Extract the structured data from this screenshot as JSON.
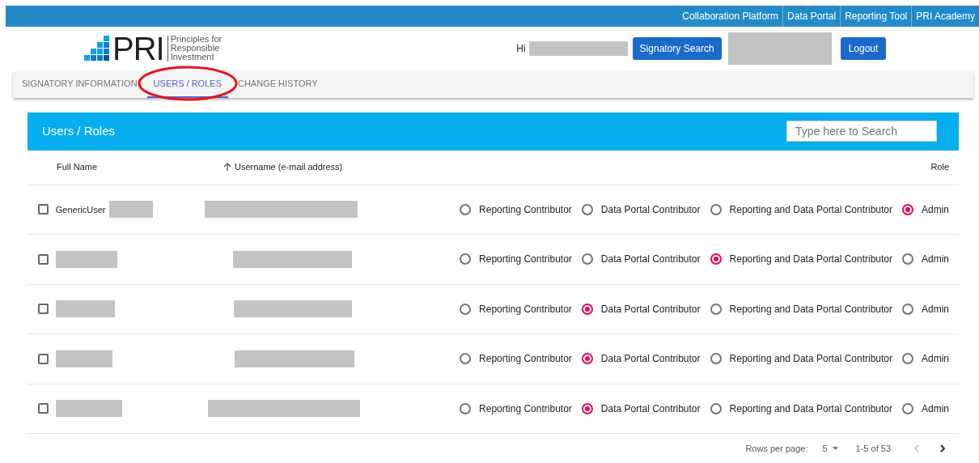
{
  "top_links": [
    "Collaboration Platform",
    "Data Portal",
    "Reporting Tool",
    "PRI Academy"
  ],
  "logo": {
    "mark": "PRI",
    "tagline": [
      "Principles for",
      "Responsible",
      "Investment"
    ]
  },
  "header": {
    "greeting": "Hi",
    "buttons": [
      "Signatory Search",
      "Logout"
    ]
  },
  "tabs": [
    {
      "label": "SIGNATORY INFORMATION",
      "selected": false
    },
    {
      "label": "USERS / ROLES",
      "selected": true
    },
    {
      "label": "CHANGE HISTORY",
      "selected": false
    }
  ],
  "panel": {
    "title": "Users / Roles",
    "search": {
      "placeholder": "Type here to Search"
    }
  },
  "table": {
    "columns": [
      {
        "label": "Full Name",
        "sorted": false
      },
      {
        "label": "Username (e-mail address)",
        "sorted": true
      },
      {
        "label": "Role",
        "sorted": false
      }
    ],
    "rows": [
      {
        "checked": false,
        "name": "GenericUser",
        "roles": [
          {
            "label": "Reporting Contributor",
            "selected": false
          },
          {
            "label": "Data Portal Contributor",
            "selected": false
          },
          {
            "label": "Reporting and Data Portal Contributor",
            "selected": false
          },
          {
            "label": "Admin",
            "selected": true
          }
        ]
      },
      {
        "checked": false,
        "roles": [
          {
            "label": "Reporting Contributor",
            "selected": false
          },
          {
            "label": "Data Portal Contributor",
            "selected": false
          },
          {
            "label": "Reporting and Data Portal Contributor",
            "selected": true
          },
          {
            "label": "Admin",
            "selected": false
          }
        ]
      },
      {
        "checked": false,
        "roles": [
          {
            "label": "Reporting Contributor",
            "selected": false
          },
          {
            "label": "Data Portal Contributor",
            "selected": true
          },
          {
            "label": "Reporting and Data Portal Contributor",
            "selected": false
          },
          {
            "label": "Admin",
            "selected": false
          }
        ]
      },
      {
        "checked": false,
        "roles": [
          {
            "label": "Reporting Contributor",
            "selected": false
          },
          {
            "label": "Data Portal Contributor",
            "selected": true
          },
          {
            "label": "Reporting and Data Portal Contributor",
            "selected": false
          },
          {
            "label": "Admin",
            "selected": false
          }
        ]
      },
      {
        "checked": false,
        "roles": [
          {
            "label": "Reporting Contributor",
            "selected": false
          },
          {
            "label": "Data Portal Contributor",
            "selected": true
          },
          {
            "label": "Reporting and Data Portal Contributor",
            "selected": false
          },
          {
            "label": "Admin",
            "selected": false
          }
        ]
      }
    ]
  },
  "pagination": {
    "rows_per_page_label": "Rows per page:",
    "rows_per_page": "5",
    "range": "1-5 of 53",
    "prev_disabled": true,
    "next_disabled": false
  }
}
